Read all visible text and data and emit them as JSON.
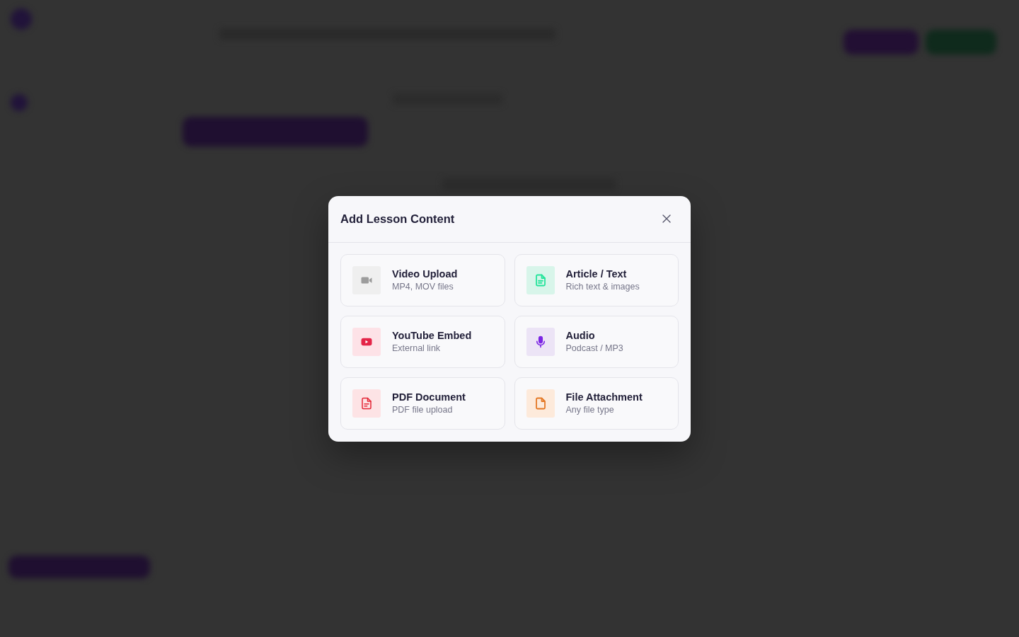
{
  "dialog": {
    "title": "Add Lesson Content",
    "options": [
      {
        "kind": "video",
        "title": "Video Upload",
        "subtitle": "MP4, MOV files",
        "color": "#efefef"
      },
      {
        "kind": "article",
        "title": "Article / Text",
        "subtitle": "Rich text & images",
        "color": "#d8f5ea"
      },
      {
        "kind": "youtube",
        "title": "YouTube Embed",
        "subtitle": "External link",
        "color": "#fde2e7"
      },
      {
        "kind": "audio",
        "title": "Audio",
        "subtitle": "Podcast / MP3",
        "color": "#ece4f6"
      },
      {
        "kind": "pdf",
        "title": "PDF Document",
        "subtitle": "PDF file upload",
        "color": "#fde3e5"
      },
      {
        "kind": "file",
        "title": "File Attachment",
        "subtitle": "Any file type",
        "color": "#fdeadb"
      }
    ]
  }
}
